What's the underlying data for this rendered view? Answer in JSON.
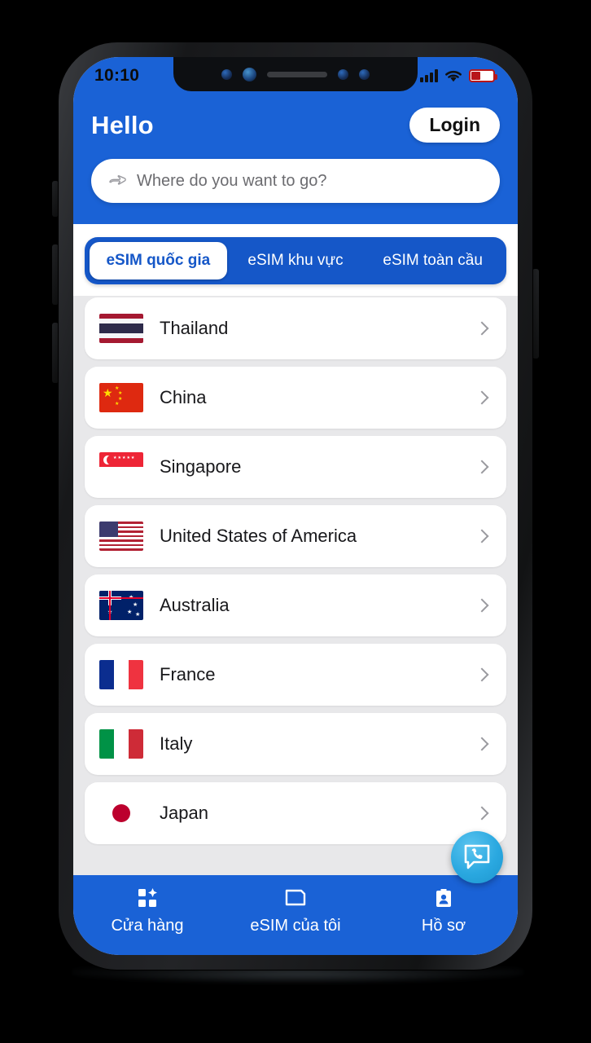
{
  "colors": {
    "brand_blue": "#1A62D6",
    "tab_blue": "#1557C8",
    "list_bg": "#E8E8EA",
    "fab_blue": "#2AA8E0"
  },
  "status_bar": {
    "time": "10:10",
    "signal_icon": "signal-bars-icon",
    "wifi_icon": "wifi-icon",
    "battery_icon": "battery-icon"
  },
  "header": {
    "greeting": "Hello",
    "login_label": "Login",
    "search": {
      "placeholder": "Where do you want to go?",
      "icon": "pointing-hand-icon"
    }
  },
  "tabs": [
    {
      "label": "eSIM quốc gia",
      "active": true
    },
    {
      "label": "eSIM khu vực",
      "active": false
    },
    {
      "label": "eSIM toàn cầu",
      "active": false
    }
  ],
  "countries": [
    {
      "name": "Thailand",
      "flag": "th"
    },
    {
      "name": "China",
      "flag": "cn"
    },
    {
      "name": "Singapore",
      "flag": "sg"
    },
    {
      "name": "United States of America",
      "flag": "us"
    },
    {
      "name": "Australia",
      "flag": "au"
    },
    {
      "name": "France",
      "flag": "fr"
    },
    {
      "name": "Italy",
      "flag": "it"
    },
    {
      "name": "Japan",
      "flag": "jp"
    }
  ],
  "fab": {
    "icon": "chat-support-icon"
  },
  "bottom_nav": [
    {
      "label": "Cửa hàng",
      "icon": "grid-store-icon"
    },
    {
      "label": "eSIM của tôi",
      "icon": "sim-card-icon"
    },
    {
      "label": "Hồ sơ",
      "icon": "profile-badge-icon"
    }
  ]
}
